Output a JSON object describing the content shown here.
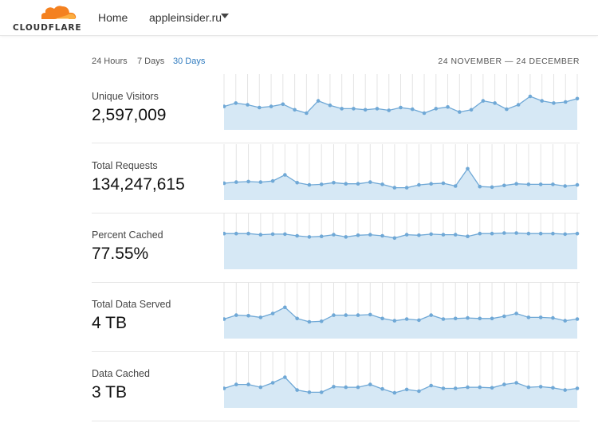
{
  "nav": {
    "brand": "CLOUDFLARE",
    "home": "Home",
    "domain": "appleinsider.ru"
  },
  "range": {
    "options": [
      "24 Hours",
      "7 Days",
      "30 Days"
    ],
    "active": "30 Days",
    "period": "24 NOVEMBER — 24 DECEMBER"
  },
  "colors": {
    "accent": "#2f7bbf",
    "spark_line": "#6fa8d6",
    "spark_fill": "#d6e8f5",
    "brand_orange": "#f48120"
  },
  "metrics": [
    {
      "label": "Unique Visitors",
      "value": "2,597,009",
      "series": [
        0.42,
        0.48,
        0.45,
        0.4,
        0.42,
        0.46,
        0.36,
        0.3,
        0.52,
        0.44,
        0.38,
        0.38,
        0.36,
        0.38,
        0.35,
        0.4,
        0.37,
        0.3,
        0.38,
        0.41,
        0.32,
        0.36,
        0.52,
        0.48,
        0.37,
        0.45,
        0.6,
        0.52,
        0.48,
        0.5,
        0.56
      ]
    },
    {
      "label": "Total Requests",
      "value": "134,247,615",
      "series": [
        0.3,
        0.32,
        0.33,
        0.32,
        0.34,
        0.45,
        0.31,
        0.27,
        0.28,
        0.31,
        0.29,
        0.29,
        0.32,
        0.28,
        0.22,
        0.22,
        0.27,
        0.29,
        0.3,
        0.25,
        0.56,
        0.24,
        0.23,
        0.26,
        0.29,
        0.28,
        0.28,
        0.28,
        0.25,
        0.27
      ]
    },
    {
      "label": "Percent Cached",
      "value": "77.55%",
      "series": [
        0.64,
        0.64,
        0.64,
        0.62,
        0.63,
        0.63,
        0.6,
        0.58,
        0.59,
        0.62,
        0.58,
        0.61,
        0.62,
        0.6,
        0.56,
        0.62,
        0.61,
        0.63,
        0.62,
        0.62,
        0.59,
        0.64,
        0.64,
        0.65,
        0.65,
        0.64,
        0.64,
        0.64,
        0.63,
        0.64
      ]
    },
    {
      "label": "Total Data Served",
      "value": "4 TB",
      "series": [
        0.35,
        0.42,
        0.41,
        0.38,
        0.45,
        0.56,
        0.36,
        0.3,
        0.31,
        0.42,
        0.42,
        0.42,
        0.43,
        0.36,
        0.32,
        0.35,
        0.33,
        0.42,
        0.35,
        0.36,
        0.37,
        0.36,
        0.36,
        0.4,
        0.45,
        0.38,
        0.38,
        0.37,
        0.32,
        0.35
      ]
    },
    {
      "label": "Data Cached",
      "value": "3 TB",
      "series": [
        0.35,
        0.42,
        0.42,
        0.37,
        0.45,
        0.55,
        0.32,
        0.28,
        0.28,
        0.38,
        0.37,
        0.37,
        0.42,
        0.34,
        0.27,
        0.33,
        0.3,
        0.4,
        0.35,
        0.35,
        0.37,
        0.37,
        0.36,
        0.42,
        0.45,
        0.37,
        0.38,
        0.36,
        0.32,
        0.35
      ]
    }
  ]
}
